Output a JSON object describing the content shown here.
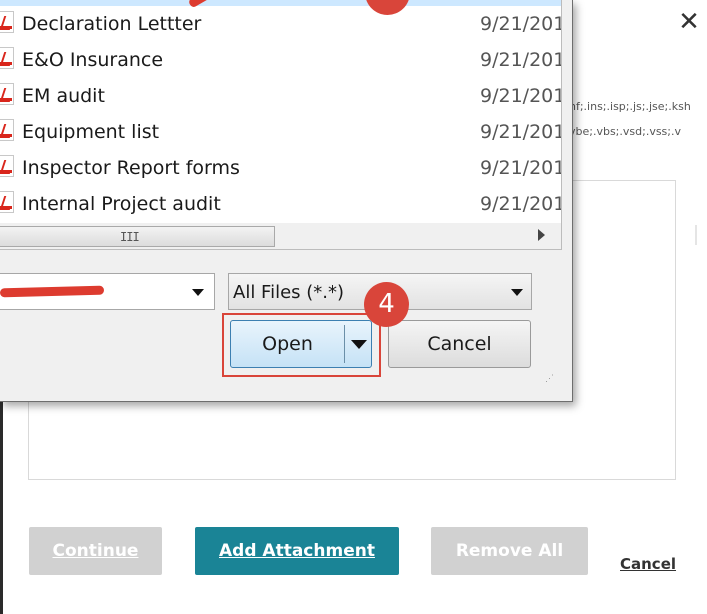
{
  "background_modal": {
    "close_glyph": "✕",
    "extensions_line_1": "hf;.ins;.isp;.js;.jse;.ksh",
    "extensions_line_2": "vbe;.vbs;.vsd;.vss;.v",
    "buttons": {
      "continue": "Continue",
      "add_attachment": "Add Attachment",
      "remove_all": "Remove All",
      "cancel": "Cancel"
    },
    "colors": {
      "primary": "#1a8496",
      "disabled": "#d1d1d1"
    }
  },
  "file_dialog": {
    "files": [
      {
        "name": "Declaration Lettter",
        "date": "9/21/201",
        "icon": "pdf-icon"
      },
      {
        "name": "E&O Insurance",
        "date": "9/21/201",
        "icon": "pdf-icon"
      },
      {
        "name": "EM audit",
        "date": "9/21/201",
        "icon": "pdf-icon"
      },
      {
        "name": "Equipment list",
        "date": "9/21/201",
        "icon": "pdf-icon"
      },
      {
        "name": "Inspector Report forms",
        "date": "9/21/201",
        "icon": "pdf-icon"
      },
      {
        "name": "Internal Project audit",
        "date": "9/21/201",
        "icon": "pdf-icon"
      }
    ],
    "scroll_grip": "III",
    "file_name_value": "",
    "file_type_filter": "All Files (*.*)",
    "open_label": "Open",
    "cancel_label": "Cancel"
  },
  "annotations": {
    "step_open": "4",
    "step_top": "",
    "highlight_color": "#d9453a"
  }
}
